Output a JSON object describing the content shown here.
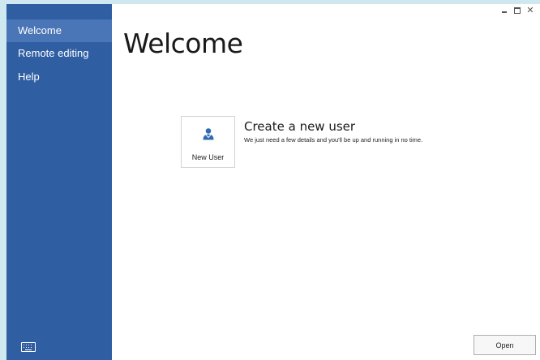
{
  "sidebar": {
    "items": [
      {
        "label": "Welcome",
        "active": true
      },
      {
        "label": "Remote editing",
        "active": false
      },
      {
        "label": "Help",
        "active": false
      }
    ],
    "footer_icon": "keyboard-icon",
    "background_color": "#2f5ea2",
    "active_color": "#4a75b6"
  },
  "window_controls": {
    "minimize_icon": "minimize-icon",
    "maximize_icon": "maximize-icon",
    "close_icon": "close-icon",
    "close_glyph": "✕"
  },
  "main": {
    "title": "Welcome",
    "new_user_tile": {
      "icon": "user-icon",
      "label": "New User",
      "icon_color": "#2f6bb3"
    },
    "create_title": "Create a new user",
    "create_description": "We just need a few details and you'll be up and running in no time.",
    "open_label": "Open"
  }
}
